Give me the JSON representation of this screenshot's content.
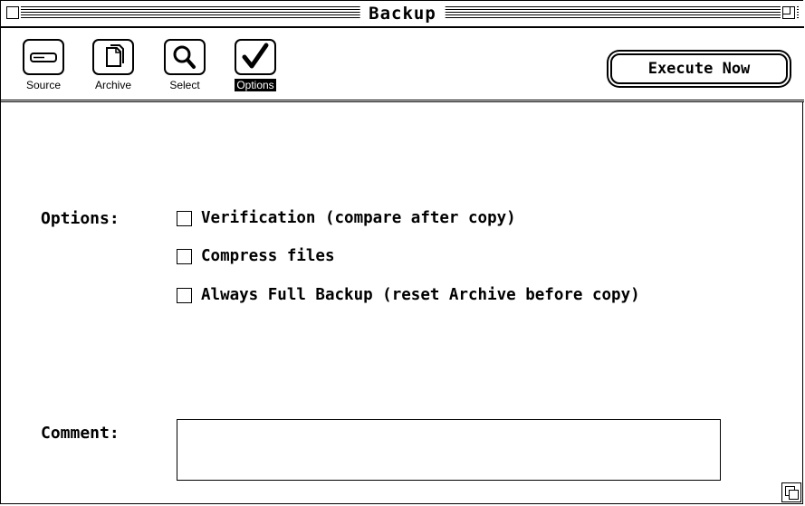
{
  "window": {
    "title": "Backup"
  },
  "toolbar": {
    "tools": [
      {
        "label": "Source",
        "icon": "disk-drive-icon"
      },
      {
        "label": "Archive",
        "icon": "documents-icon"
      },
      {
        "label": "Select",
        "icon": "magnifier-icon"
      },
      {
        "label": "Options",
        "icon": "checkmark-icon",
        "selected": true
      }
    ],
    "execute_label": "Execute Now"
  },
  "options": {
    "label": "Options:",
    "items": [
      {
        "label": "Verification (compare after copy)",
        "checked": false
      },
      {
        "label": "Compress files",
        "checked": false
      },
      {
        "label": "Always Full Backup (reset Archive before copy)",
        "checked": false
      }
    ]
  },
  "comment": {
    "label": "Comment:",
    "value": ""
  }
}
